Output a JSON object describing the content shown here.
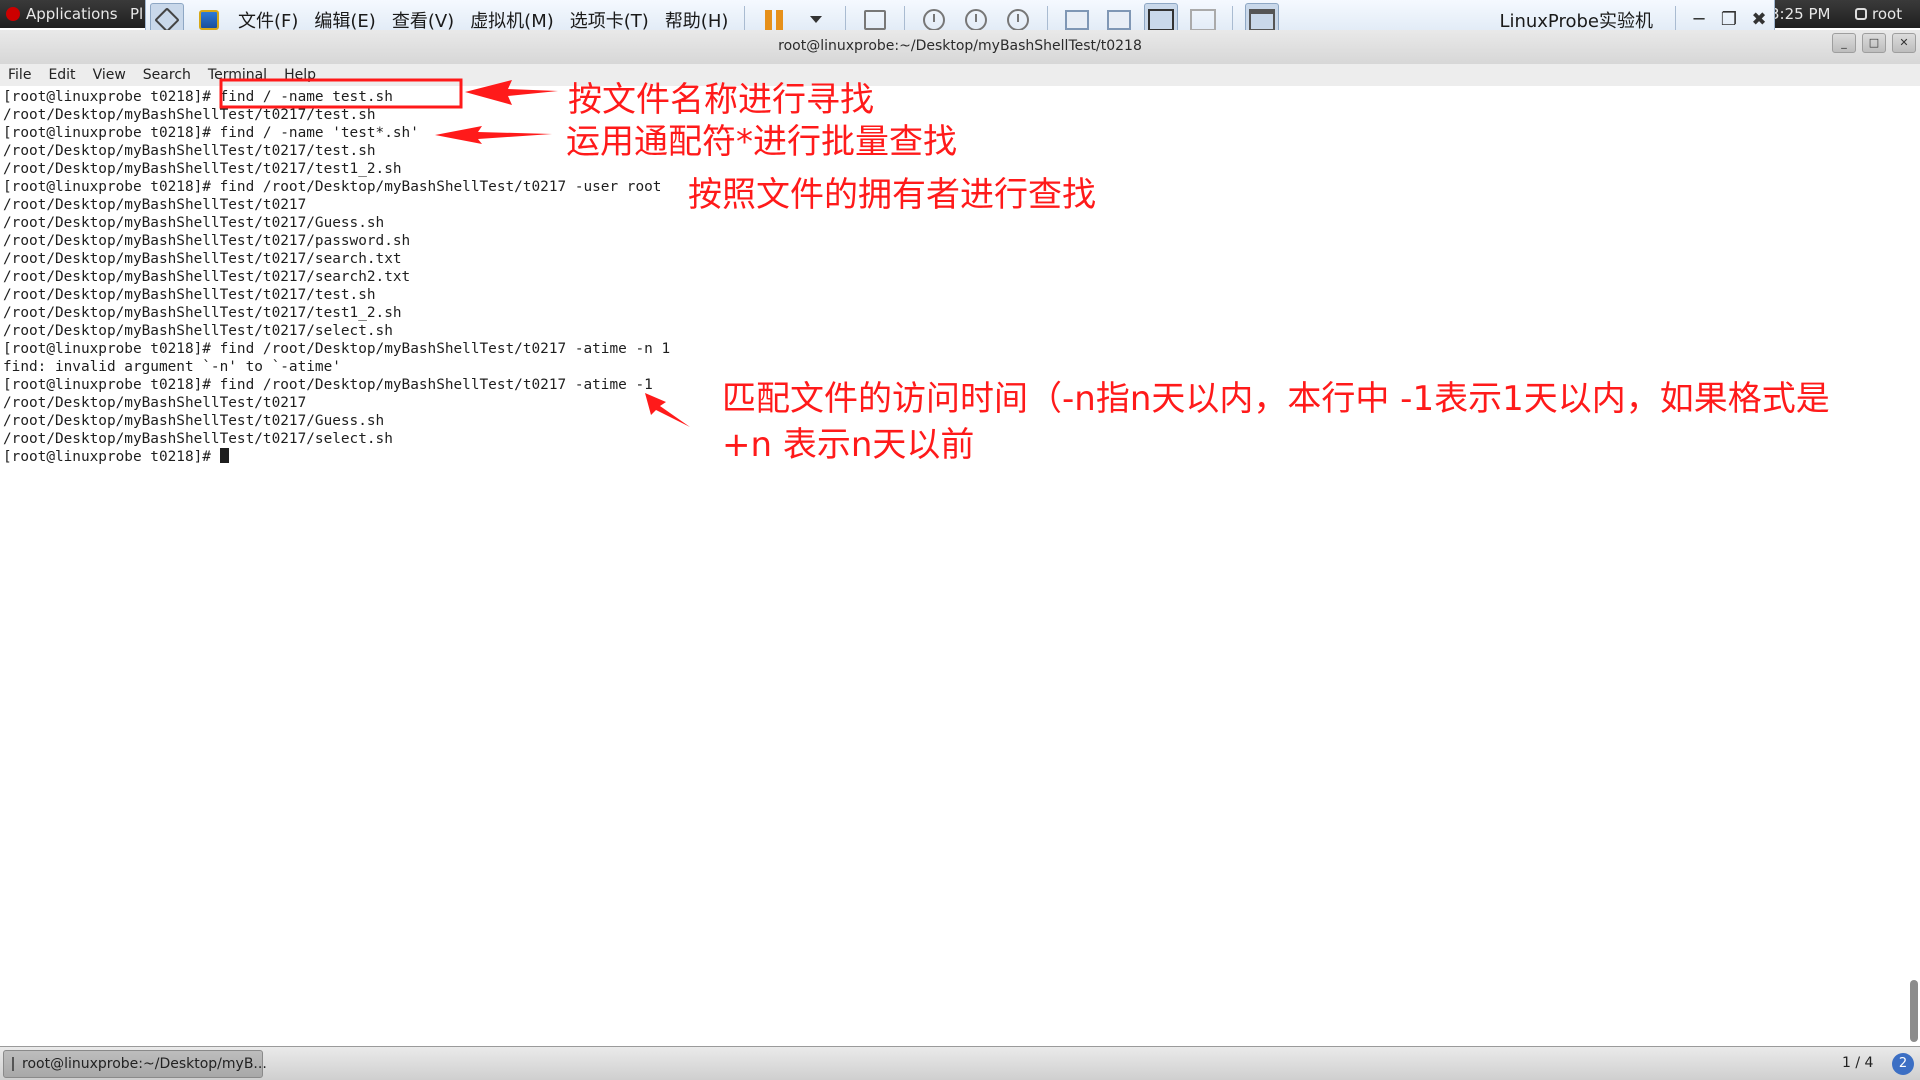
{
  "top_panel": {
    "applications": "Applications",
    "places": "Pl",
    "clock": "3:25 PM",
    "user": "root"
  },
  "vm_toolbar": {
    "menus": [
      "文件(F)",
      "编辑(E)",
      "查看(V)",
      "虚拟机(M)",
      "选项卡(T)",
      "帮助(H)"
    ],
    "title": "LinuxProbe实验机"
  },
  "terminal": {
    "window_title": "root@linuxprobe:~/Desktop/myBashShellTest/t0218",
    "menubar": [
      "File",
      "Edit",
      "View",
      "Search",
      "Terminal",
      "Help"
    ],
    "lines": [
      "[root@linuxprobe t0218]# find / -name test.sh",
      "/root/Desktop/myBashShellTest/t0217/test.sh",
      "[root@linuxprobe t0218]# find / -name 'test*.sh'",
      "/root/Desktop/myBashShellTest/t0217/test.sh",
      "/root/Desktop/myBashShellTest/t0217/test1_2.sh",
      "[root@linuxprobe t0218]# find /root/Desktop/myBashShellTest/t0217 -user root",
      "/root/Desktop/myBashShellTest/t0217",
      "/root/Desktop/myBashShellTest/t0217/Guess.sh",
      "/root/Desktop/myBashShellTest/t0217/password.sh",
      "/root/Desktop/myBashShellTest/t0217/search.txt",
      "/root/Desktop/myBashShellTest/t0217/search2.txt",
      "/root/Desktop/myBashShellTest/t0217/test.sh",
      "/root/Desktop/myBashShellTest/t0217/test1_2.sh",
      "/root/Desktop/myBashShellTest/t0217/select.sh",
      "[root@linuxprobe t0218]# find /root/Desktop/myBashShellTest/t0217 -atime -n 1",
      "find: invalid argument `-n' to `-atime'",
      "[root@linuxprobe t0218]# find /root/Desktop/myBashShellTest/t0217 -atime -1",
      "/root/Desktop/myBashShellTest/t0217",
      "/root/Desktop/myBashShellTest/t0217/Guess.sh",
      "/root/Desktop/myBashShellTest/t0217/select.sh"
    ],
    "prompt": "[root@linuxprobe t0218]# "
  },
  "annotations": {
    "color": "#ff1a1a",
    "a1": "按文件名称进行寻找",
    "a2": "运用通配符*进行批量查找",
    "a3": "按照文件的拥有者进行查找",
    "a4_line1": "匹配文件的访问时间（-n指n天以内，本行中 -1表示1天以内，如果格式是",
    "a4_line2": "+n 表示n天以前"
  },
  "taskbar": {
    "task_label": "root@linuxprobe:~/Desktop/myB...",
    "workspace": "1 / 4"
  }
}
